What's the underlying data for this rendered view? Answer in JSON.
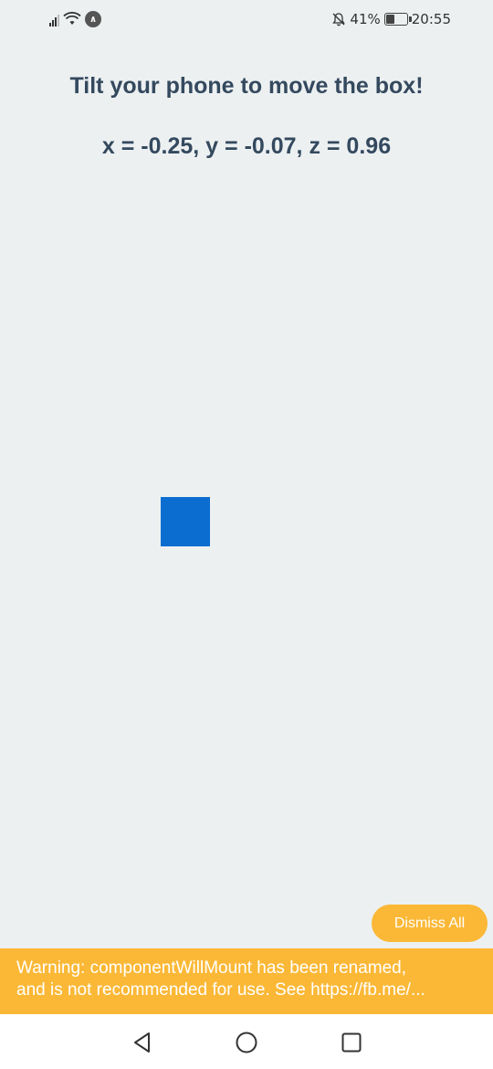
{
  "status_bar": {
    "notification_icon": "app-badge-icon",
    "battery_percent": "41%",
    "time": "20:55"
  },
  "main": {
    "title": "Tilt your phone to move the box!",
    "coords": "x = -0.25, y = -0.07, z = 0.96",
    "box_color": "#0b6dd0"
  },
  "warning": {
    "dismiss_label": "Dismiss All",
    "line1": "Warning: componentWillMount has been renamed,",
    "line2": "and is not recommended for use. See https://fb.me/..."
  },
  "colors": {
    "background": "#ecf0f1",
    "text": "#34495e",
    "warning": "#fbb836"
  },
  "nav_bar": {
    "icons": [
      "back-icon",
      "home-icon",
      "recent-apps-icon"
    ]
  }
}
